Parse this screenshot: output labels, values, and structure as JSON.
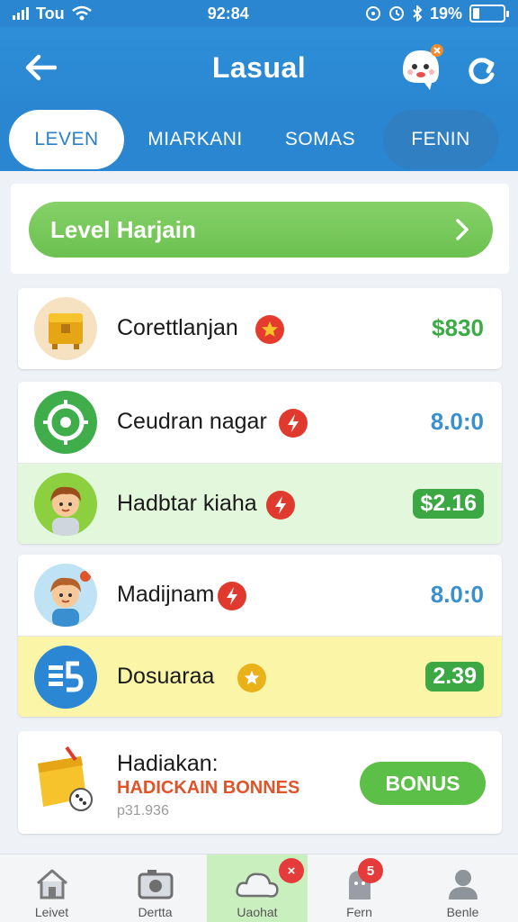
{
  "status_bar": {
    "carrier": "Tou",
    "time": "92:84",
    "battery": "19%"
  },
  "header": {
    "title": "Lasual",
    "back_icon": "arrow-left-icon",
    "refresh_icon": "refresh-icon",
    "mascot_icon": "ghost-mascot-icon"
  },
  "tabs": [
    {
      "label": "LEVEN",
      "active": true
    },
    {
      "label": "MIARKANI",
      "active": false
    },
    {
      "label": "SOMAS",
      "active": false
    },
    {
      "label": "FENIN",
      "active": false
    }
  ],
  "level_button": {
    "label": "Level Harjain"
  },
  "rows": [
    {
      "label": "Corettlanjan",
      "value": "$830",
      "icon": "treasure-chest-icon",
      "badge": "star-badge-icon"
    },
    {
      "label": "Ceudran nagar",
      "value": "8.0:0",
      "icon": "target-icon",
      "badge": "lightning-badge-icon"
    },
    {
      "label": "Hadbtar kiaha",
      "value": "$2.16",
      "icon": "boy-avatar-icon",
      "badge": "lightning-badge-icon"
    },
    {
      "label": "Madijnam",
      "value": "8.0:0",
      "icon": "boy-avatar-icon",
      "badge": "lightning-badge-icon"
    },
    {
      "label": "Dosuaraa",
      "value": "2.39",
      "icon": "dollar-card-icon",
      "badge": "star-badge-icon"
    }
  ],
  "bonus": {
    "title": "Hadiakan:",
    "subtitle": "HADICKAIN BONNES",
    "code": "p31.936",
    "button_label": "BONUS"
  },
  "bottom_nav": [
    {
      "label": "Leivet",
      "icon": "home-icon"
    },
    {
      "label": "Dertta",
      "icon": "camera-icon"
    },
    {
      "label": "Uaohat",
      "icon": "cloud-icon",
      "active": true,
      "badge": "×"
    },
    {
      "label": "Fern",
      "icon": "tombstone-icon",
      "badge": "5"
    },
    {
      "label": "Benle",
      "icon": "user-icon"
    }
  ],
  "colors": {
    "primary": "#2a86d0",
    "green": "#6bc150",
    "highlight_green": "#e2f7dc",
    "highlight_yellow": "#fbf5a8",
    "badge_red": "#e53b3b"
  }
}
